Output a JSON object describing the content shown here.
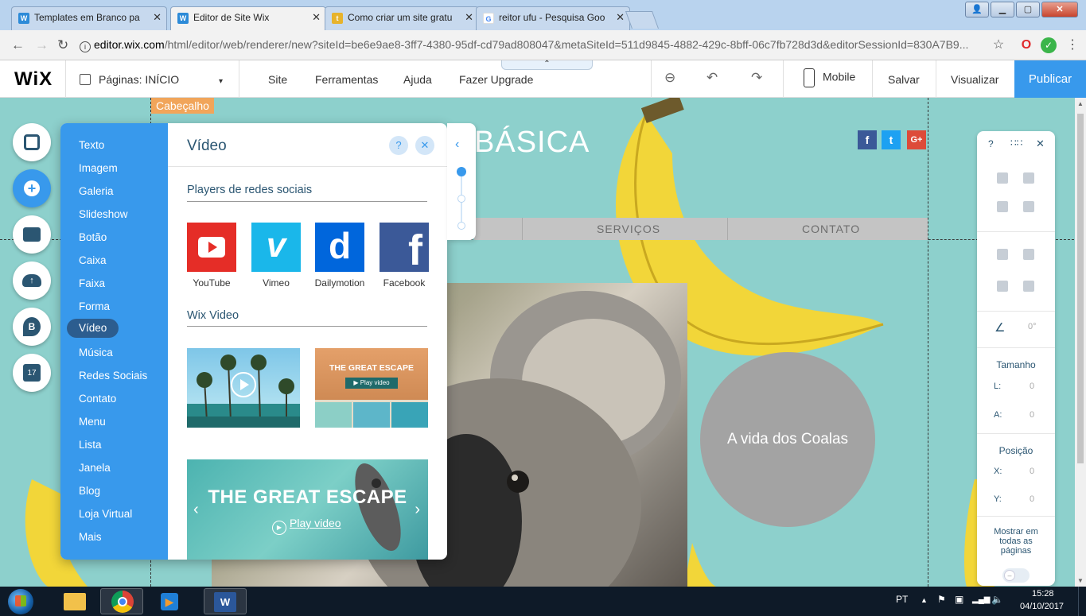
{
  "browser": {
    "tabs": [
      {
        "title": "Templates em Branco pa",
        "favicon": "wix-favicon",
        "active": false
      },
      {
        "title": "Editor de Site Wix",
        "favicon": "wix-favicon",
        "active": true
      },
      {
        "title": "Como criar um site gratu",
        "favicon": "tecmundo-favicon",
        "active": false
      },
      {
        "title": "reitor ufu - Pesquisa Goo",
        "favicon": "google-favicon",
        "active": false
      }
    ],
    "url_host": "editor.wix.com",
    "url_path": "/html/editor/web/renderer/new?siteId=be6e9ae8-3ff7-4380-95df-cd79ad808047&metaSiteId=511d9845-4882-429c-8bff-06c7fb728d3d&editorSessionId=830A7B9..."
  },
  "wix_topbar": {
    "logo": "WiX",
    "pages_label": "Páginas: INÍCIO",
    "menu": [
      "Site",
      "Ferramentas",
      "Ajuda",
      "Fazer Upgrade"
    ],
    "mobile_label": "Mobile",
    "save_label": "Salvar",
    "preview_label": "Visualizar",
    "publish_label": "Publicar"
  },
  "canvas": {
    "header_tag": "Cabeçalho",
    "site_title_fragment": "BÁSICA",
    "menu_items": [
      "SERVIÇOS",
      "CONTATO"
    ],
    "social": [
      "f",
      "t",
      "G+"
    ],
    "circle_text": "A vida dos Coalas"
  },
  "add_panel": {
    "categories": [
      "Texto",
      "Imagem",
      "Galeria",
      "Slideshow",
      "Botão",
      "Caixa",
      "Faixa",
      "Forma",
      "Vídeo",
      "Música",
      "Redes Sociais",
      "Contato",
      "Menu",
      "Lista",
      "Janela",
      "Blog",
      "Loja Virtual",
      "Mais"
    ],
    "selected_category": "Vídeo",
    "title": "Vídeo",
    "help": "?",
    "section_social": "Players de redes sociais",
    "players": [
      {
        "name": "YouTube",
        "color": "#e52d27"
      },
      {
        "name": "Vimeo",
        "color": "#1ab7ea"
      },
      {
        "name": "Dailymotion",
        "color": "#0066dc"
      },
      {
        "name": "Facebook",
        "color": "#3b5998"
      }
    ],
    "section_wix": "Wix Video",
    "thumb_escape_title": "THE GREAT ESCAPE",
    "thumb_play": "▶ Play video",
    "banner_title": "THE GREAT ESCAPE",
    "banner_play": "Play video"
  },
  "inspector": {
    "help": "?",
    "rotation": "0°",
    "size_title": "Tamanho",
    "w_label": "L:",
    "w_value": "0",
    "h_label": "A:",
    "h_value": "0",
    "pos_title": "Posição",
    "x_label": "X:",
    "x_value": "0",
    "y_label": "Y:",
    "y_value": "0",
    "show_all": "Mostrar em todas as páginas"
  },
  "taskbar": {
    "lang": "PT",
    "time": "15:28",
    "date": "04/10/2017"
  },
  "colors": {
    "wix_blue": "#3899ec",
    "canvas_bg": "#8dd0cc",
    "header_tag": "#f1a55a",
    "circle": "#a3a3a3"
  }
}
